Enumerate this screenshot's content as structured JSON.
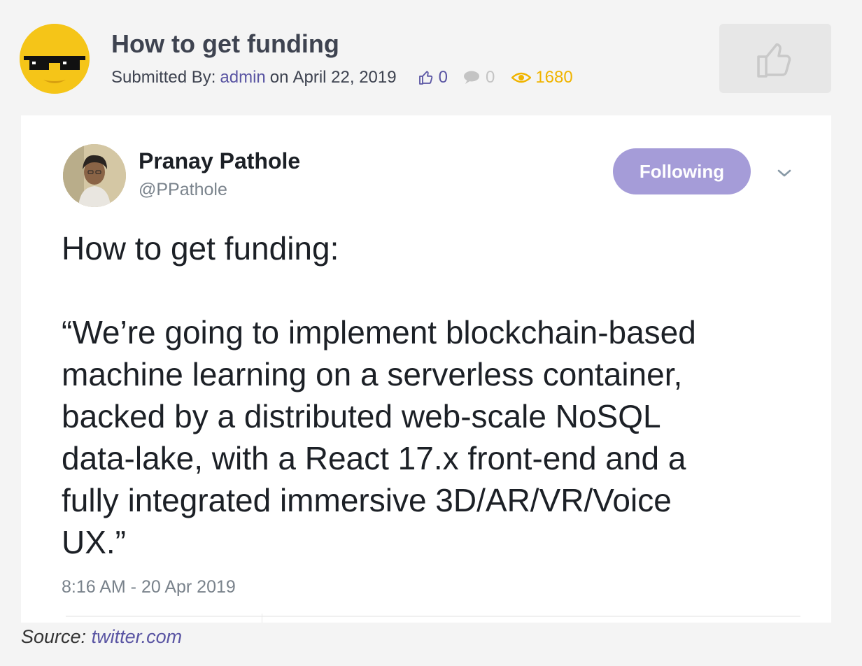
{
  "post": {
    "title": "How to get funding",
    "submitted_label": "Submitted By:",
    "author": "admin",
    "on_label": "on",
    "date": "April 22, 2019",
    "likes": "0",
    "comments": "0",
    "views": "1680"
  },
  "tweet": {
    "name": "Pranay Pathole",
    "handle": "@PPathole",
    "follow_label": "Following",
    "text_lines_1": [
      "How to get funding:"
    ],
    "text_lines_2": [
      "“We’re going to implement blockchain-based",
      "machine learning on a serverless container,",
      "backed by a distributed web-scale NoSQL",
      "data-lake, with a React 17.x front-end and a",
      "fully integrated immersive 3D/AR/VR/Voice",
      "UX.”"
    ],
    "time": "8:16 AM - 20 Apr 2019"
  },
  "source": {
    "label": "Source:",
    "link": "twitter.com"
  },
  "colors": {
    "accent": "#5a55a3",
    "views": "#f0b400",
    "follow_button": "#a59cd8"
  },
  "icons": {
    "like": "thumbs-up-icon",
    "comment": "comment-icon",
    "views": "eye-icon",
    "caret": "chevron-down-icon"
  }
}
